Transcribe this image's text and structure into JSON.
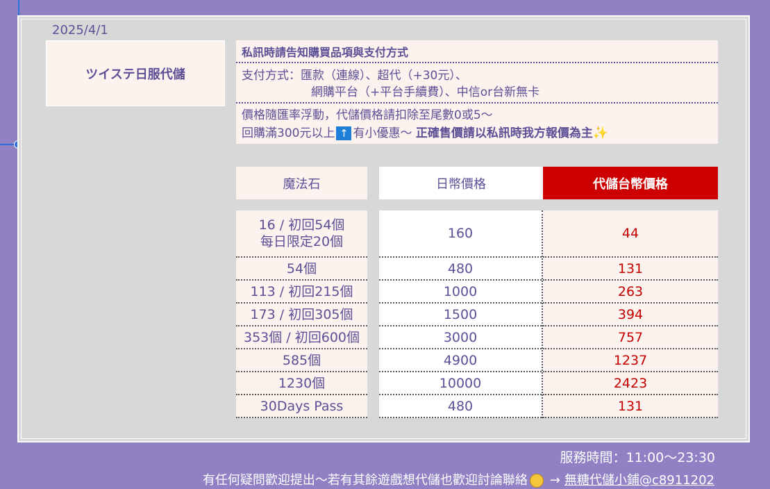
{
  "date": "2025/4/1",
  "shop_title": "ツイステ日服代儲",
  "info": {
    "line1": "私訊時請告知購買品項與支付方式",
    "pay_line1": "支付方式：匯款（連線）、超代（+30元）、",
    "pay_line2": "網購平台（+平台手續費）、中信or台新無卡",
    "price_note": "價格隨匯率浮動，代儲價格請扣除至尾數0或5～",
    "discount_pre": "回購滿300元以上",
    "discount_arrow": "↑",
    "discount_mid": "有小優惠～",
    "discount_bold": "正確售價請以私訊時我方報價為主",
    "sparkle_icon": "✨"
  },
  "table": {
    "headers": [
      "魔法石",
      "日幣價格",
      "代儲台幣價格"
    ],
    "rows": [
      {
        "item": "16 / 初回54個\n每日限定20個",
        "jpy": "160",
        "twd": "44"
      },
      {
        "item": "54個",
        "jpy": "480",
        "twd": "131"
      },
      {
        "item": "113 / 初回215個",
        "jpy": "1000",
        "twd": "263"
      },
      {
        "item": "173 / 初回305個",
        "jpy": "1500",
        "twd": "394"
      },
      {
        "item": "353個 / 初回600個",
        "jpy": "3000",
        "twd": "757"
      },
      {
        "item": "585個",
        "jpy": "4900",
        "twd": "1237"
      },
      {
        "item": "1230個",
        "jpy": "10000",
        "twd": "2423"
      },
      {
        "item": "30Days Pass",
        "jpy": "480",
        "twd": "131"
      }
    ]
  },
  "footer": {
    "service_hours": "服務時間：11:00～23:30",
    "contact_text": "有任何疑問歡迎提出～若有其餘遊戲想代儲也歡迎討論聯絡",
    "arrow": "→",
    "link": "無糖代儲小鋪@c8911202"
  },
  "colors": {
    "background": "#8f81c4",
    "accent_red": "#cc0000",
    "text_purple": "#5b4f96"
  }
}
